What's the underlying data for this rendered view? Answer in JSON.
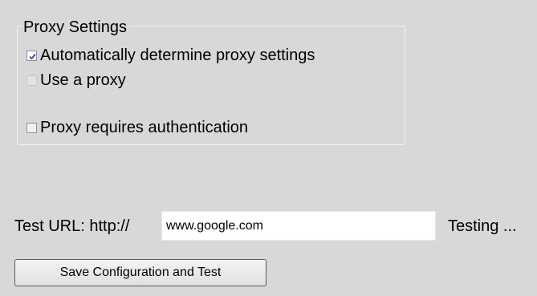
{
  "proxy_settings": {
    "legend": "Proxy Settings",
    "options": [
      {
        "label": "Automatically determine proxy settings",
        "checked": true
      },
      {
        "label": "Use a proxy",
        "checked": false
      },
      {
        "label": "Proxy requires authentication",
        "checked": false
      }
    ]
  },
  "test": {
    "label": "Test URL: http://",
    "url_value": "www.google.com",
    "status": "Testing ..."
  },
  "actions": {
    "save_label": "Save Configuration and Test"
  },
  "colors": {
    "background": "#d8d8d8",
    "checkmark": "#3c4a8c"
  },
  "icons": {
    "checked_box": "checkbox-checked-icon"
  }
}
